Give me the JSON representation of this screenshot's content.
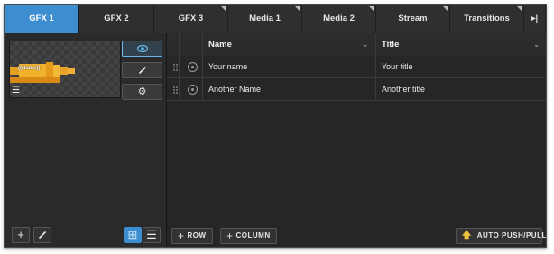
{
  "tabs": [
    {
      "label": "GFX 1",
      "active": true,
      "corner": false
    },
    {
      "label": "GFX 2",
      "active": false,
      "corner": false
    },
    {
      "label": "GFX 3",
      "active": false,
      "corner": true
    },
    {
      "label": "Media 1",
      "active": false,
      "corner": true
    },
    {
      "label": "Media 2",
      "active": false,
      "corner": true
    },
    {
      "label": "Stream",
      "active": false,
      "corner": true
    },
    {
      "label": "Transitions",
      "active": false,
      "corner": true
    }
  ],
  "tab_more_icon": "▸|",
  "thumbnail": {
    "graphic_text": "((Name))",
    "list_icon": "☰"
  },
  "side_buttons": [
    {
      "name": "eye-icon",
      "glyph": "👁"
    },
    {
      "name": "pencil-icon",
      "glyph": "✎"
    },
    {
      "name": "gear-icon",
      "glyph": "⚙"
    }
  ],
  "left_footer": {
    "add": "+",
    "edit": "✎",
    "grid_view": "⊞",
    "list_view": "☰"
  },
  "table": {
    "columns": [
      "Name",
      "Title"
    ],
    "rows": [
      {
        "name": "Your name",
        "title": "Your title"
      },
      {
        "name": "Another Name",
        "title": "Another title"
      }
    ]
  },
  "right_footer": {
    "add_row": "ROW",
    "add_column": "COLUMN",
    "auto_push": "AUTO PUSH/PULL",
    "plus": "+",
    "arrow": "🡅"
  },
  "colors": {
    "accent": "#3d8ed0",
    "eye": "#5fb6ec",
    "push_arrow": "#f0c040"
  }
}
